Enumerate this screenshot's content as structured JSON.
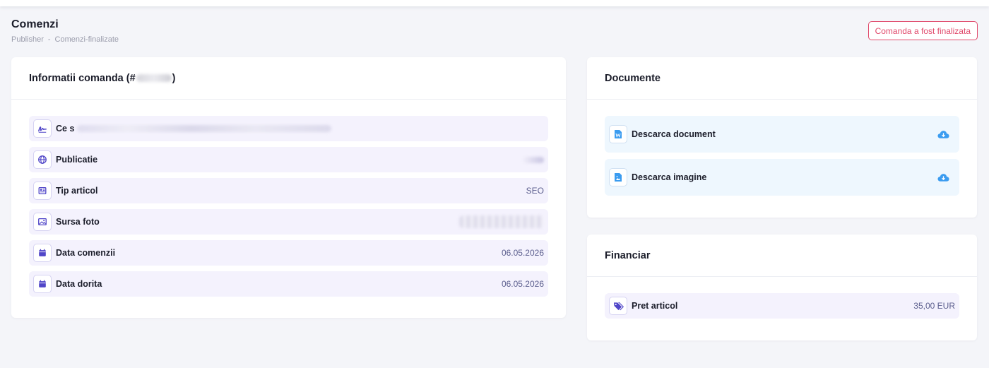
{
  "header": {
    "title": "Comenzi",
    "breadcrumb": [
      "Publisher",
      "Comenzi-finalizate"
    ],
    "breadcrumb_sep": "-",
    "status_button": "Comanda a fost finalizata"
  },
  "order_info": {
    "title": "Informatii comanda (#",
    "title_end": ")",
    "rows": [
      {
        "label": "Ce s",
        "value": "",
        "icon": "signature-icon"
      },
      {
        "label": "Publicatie",
        "value": "",
        "icon": "globe-icon"
      },
      {
        "label": "Tip articol",
        "value": "SEO",
        "icon": "newspaper-icon"
      },
      {
        "label": "Sursa foto",
        "value": "",
        "icon": "image-icon"
      },
      {
        "label": "Data comenzii",
        "value": "06.05.2026",
        "icon": "calendar-icon"
      },
      {
        "label": "Data dorita",
        "value": "06.05.2026",
        "icon": "calendar-icon"
      }
    ]
  },
  "documents": {
    "title": "Documente",
    "items": [
      {
        "label": "Descarca document",
        "icon": "word-file-icon",
        "action_icon": "cloud-download-icon"
      },
      {
        "label": "Descarca imagine",
        "icon": "image-file-icon",
        "action_icon": "cloud-download-icon"
      }
    ]
  },
  "financial": {
    "title": "Financiar",
    "rows": [
      {
        "label": "Pret articol",
        "value": "35,00 EUR",
        "icon": "tags-icon"
      }
    ]
  },
  "colors": {
    "accent": "#5046c8",
    "danger": "#e0486a",
    "info": "#3b9cf0",
    "row_bg": "#f4f2fd",
    "doc_bg": "#eef7fe"
  }
}
